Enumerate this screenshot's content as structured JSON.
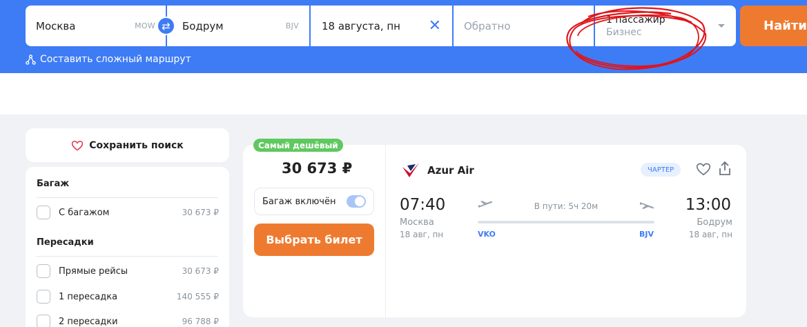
{
  "search": {
    "from_city": "Москва",
    "from_code": "MOW",
    "to_city": "Бодрум",
    "to_code": "BJV",
    "date": "18 августа, пн",
    "return_placeholder": "Обратно",
    "passengers": "1 пассажир",
    "class": "Бизнес",
    "find_label": "Найти",
    "complex_route_label": "Составить сложный маршрут"
  },
  "sidebar": {
    "save_search_label": "Сохранить поиск",
    "baggage_title": "Багаж",
    "baggage_items": [
      {
        "label": "С багажом",
        "price": "30 673 ₽"
      }
    ],
    "transfers_title": "Пересадки",
    "transfer_items": [
      {
        "label": "Прямые рейсы",
        "price": "30 673 ₽"
      },
      {
        "label": "1 пересадка",
        "price": "140 555 ₽"
      },
      {
        "label": "2 пересадки",
        "price": "96 788 ₽"
      }
    ]
  },
  "ticket": {
    "badge": "Самый дешёвый",
    "price": "30 673 ₽",
    "baggage_label": "Багаж включён",
    "baggage_included": true,
    "choose_label": "Выбрать билет",
    "airline": "Azur Air",
    "charter_label": "ЧАРТЕР",
    "dep_time": "07:40",
    "dep_city": "Москва",
    "dep_date": "18 авг, пн",
    "dep_airport": "VKO",
    "arr_time": "13:00",
    "arr_city": "Бодрум",
    "arr_date": "18 авг, пн",
    "arr_airport": "BJV",
    "duration": "В пути: 5ч 20м"
  },
  "colors": {
    "brand_blue": "#3e7cf6",
    "accent_orange": "#ee7a30",
    "badge_green": "#5fc85f",
    "annotation_red": "#e0141a"
  }
}
